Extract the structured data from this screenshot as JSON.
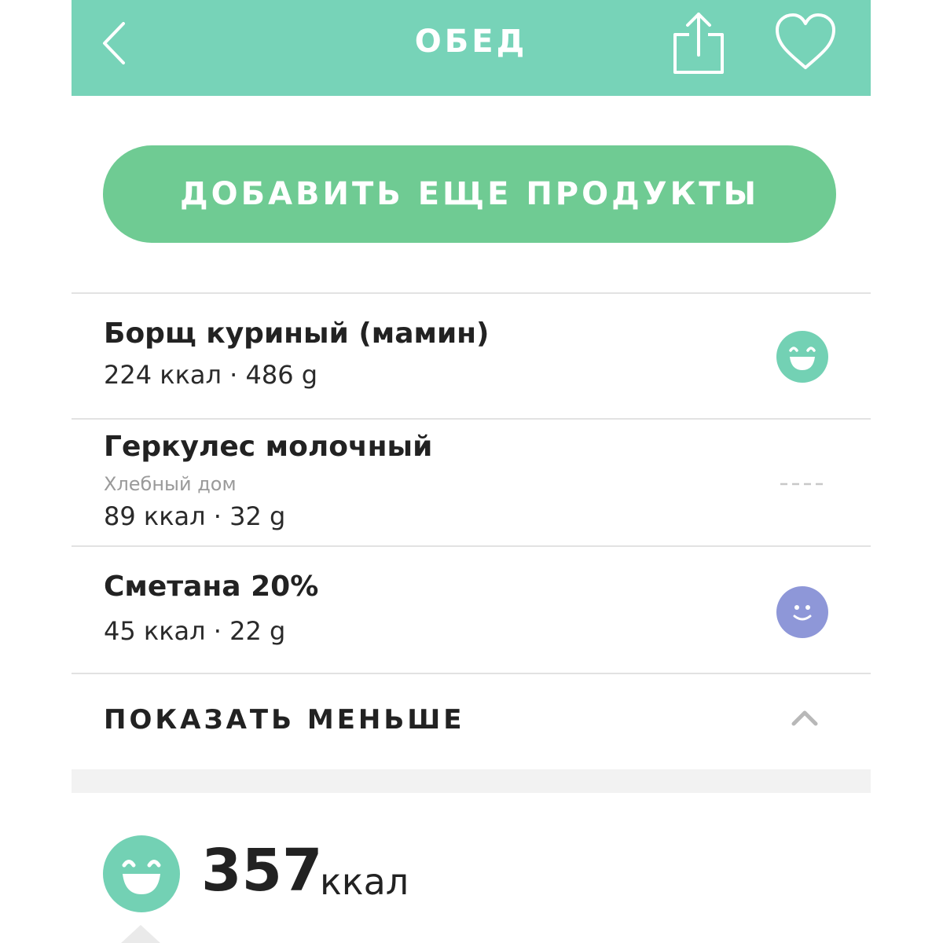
{
  "header": {
    "title": "ОБЕД",
    "icons": [
      "back-chevron-icon",
      "share-icon",
      "heart-icon"
    ],
    "color": "#77d3b8"
  },
  "add_button": {
    "label": "ДОБАВИТЬ ЕЩЕ ПРОДУКТЫ",
    "color": "#6fcb93"
  },
  "items": [
    {
      "name": "Борщ куриный (мамин)",
      "brand": "",
      "meta": "224 ккал · 486 g",
      "rating_icon": "big-smile-icon",
      "rating_color": "#73d1b4"
    },
    {
      "name": "Геркулес молочный",
      "brand": "Хлебный дом",
      "meta": "89 ккал · 32 g",
      "rating_icon": "dashed-line-icon",
      "rating_color": "#c8c8c8"
    },
    {
      "name": "Сметана 20%",
      "brand": "",
      "meta": "45 ккал · 22 g",
      "rating_icon": "small-smile-icon",
      "rating_color": "#8e97d8"
    }
  ],
  "show_less": {
    "label": "ПОКАЗАТЬ МЕНЬШЕ",
    "icon": "chevron-up-icon"
  },
  "total": {
    "value": "357",
    "unit": "ккал",
    "icon": "big-smile-icon"
  }
}
